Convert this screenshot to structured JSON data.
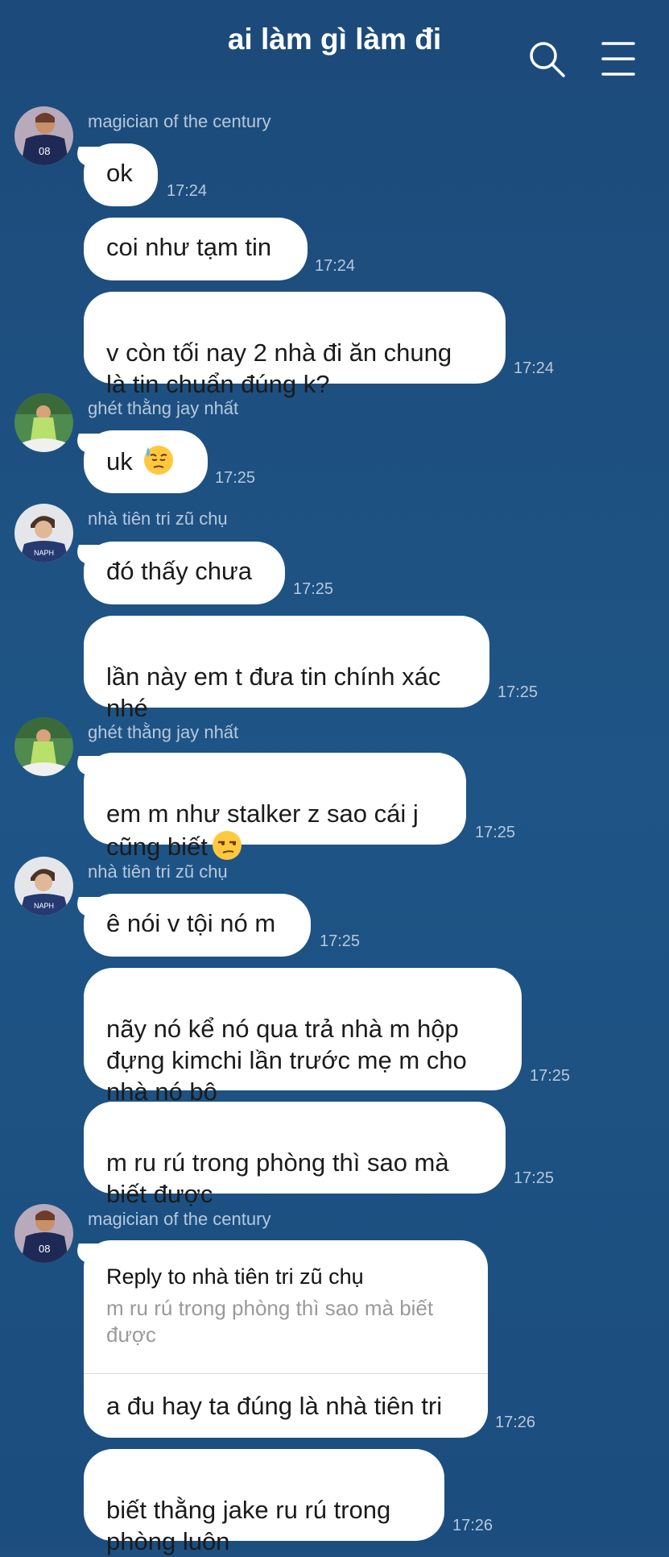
{
  "header": {
    "title": "ai làm gì làm đi",
    "icons": [
      "search-icon",
      "menu-icon"
    ]
  },
  "senders": {
    "magician": "magician of the century",
    "ghet": "ghét thằng jay nhất",
    "nha": "nhà tiên tri zũ chụ"
  },
  "messages": [
    {
      "text": "ok",
      "time": "17:24"
    },
    {
      "text": "coi như tạm tin",
      "time": "17:24"
    },
    {
      "text": "v còn tối nay 2 nhà đi ăn chung\nlà tin chuẩn đúng k?",
      "time": "17:24"
    },
    {
      "text": "uk",
      "time": "17:25",
      "emoji": "sweat-face"
    },
    {
      "text": "đó thấy chưa",
      "time": "17:25"
    },
    {
      "text": "lần này em t đưa tin chính xác\nnhé",
      "time": "17:25"
    },
    {
      "text": "em m như stalker z sao cái j\ncũng biết",
      "time": "17:25",
      "emoji": "unamused-face"
    },
    {
      "text": "ê nói v tội nó m",
      "time": "17:25"
    },
    {
      "text": "nãy nó kể nó qua trả nhà m hộp\nđựng kimchi lần trước mẹ m cho\nnhà nó bộ",
      "time": "17:25"
    },
    {
      "text": "m ru rú trong phòng thì sao mà\nbiết được",
      "time": "17:25"
    },
    {
      "text": "biết thằng jake ru rú trong\nphòng luôn",
      "time": "17:26"
    }
  ],
  "reply": {
    "header": "Reply to nhà tiên tri zũ chụ",
    "quote": "m ru rú trong phòng thì sao mà biết được",
    "text": "a đu hay ta đúng là nhà tiên tri",
    "time": "17:26"
  }
}
